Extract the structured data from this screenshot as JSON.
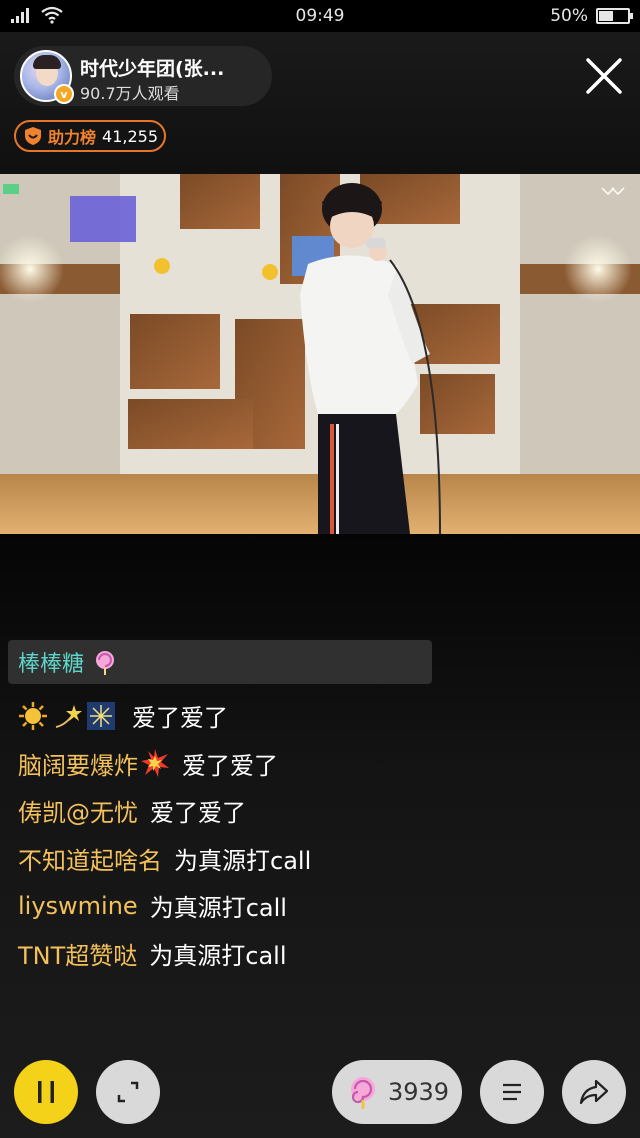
{
  "status_bar": {
    "time": "09:49",
    "battery": "50%",
    "battery_level": 0.5,
    "icons": [
      "signal-icon",
      "wifi-icon",
      "battery-icon"
    ]
  },
  "host": {
    "name": "时代少年团(张...",
    "viewers": "90.7万人观看",
    "verified_badge": "v"
  },
  "rank": {
    "label": "助力榜",
    "count": "41,255",
    "accent": "#e8762a"
  },
  "chat": {
    "gift_banner": "棒棒糖",
    "messages": [
      {
        "user": "",
        "text": "爱了爱了",
        "emojis": [
          "sun-icon",
          "shooting-star-icon",
          "sparkler-icon"
        ]
      },
      {
        "user": "脑阔要爆炸",
        "text": "爱了爱了",
        "emojis": [
          "explosion-icon"
        ]
      },
      {
        "user": "俦凯@无忧",
        "text": "爱了爱了",
        "emojis": []
      },
      {
        "user": "不知道起啥名",
        "text": "为真源打call",
        "emojis": []
      },
      {
        "user": "liyswmine",
        "text": "为真源打call",
        "emojis": []
      },
      {
        "user": "TNT超赞哒",
        "text": "为真源打call",
        "emojis": []
      }
    ],
    "user_color": "#f3c05a",
    "gift_color": "#5fd4c8"
  },
  "controls": {
    "gift_count": "3939",
    "pause_color": "#f5d21a"
  }
}
